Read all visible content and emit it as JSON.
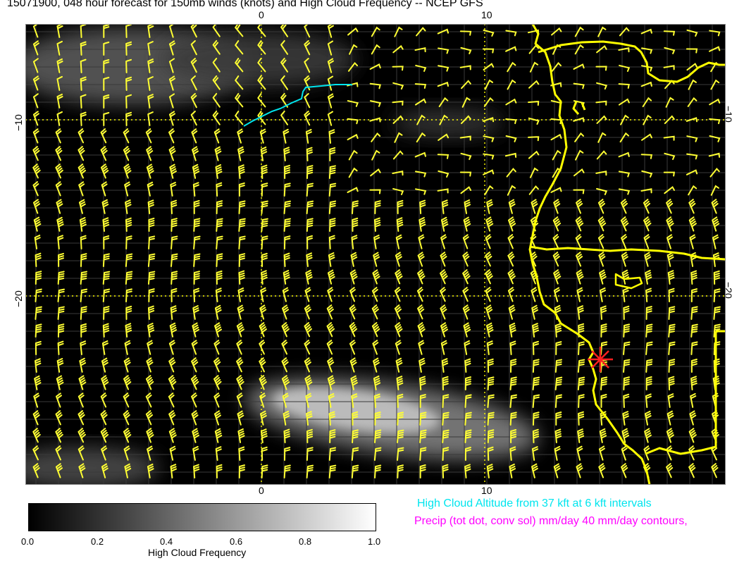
{
  "title": "15071900, 048 hour forecast for 150mb winds (knots) and High Cloud Frequency -- NCEP GFS",
  "axes": {
    "top_ticks": [
      "0",
      "10"
    ],
    "bottom_ticks": [
      "0",
      "10"
    ],
    "left_ticks": [
      "−10",
      "−20"
    ],
    "right_ticks": [
      "−10",
      "−20"
    ]
  },
  "legend": {
    "cloud_altitude_text": "High Cloud Altitude from 37 kft at 6 kft intervals",
    "precip_text": "Precip (tot dot, conv sol) mm/day 40 mm/day contours,",
    "colorbar_label": "High Cloud Frequency",
    "colorbar_ticks": [
      "0.0",
      "0.2",
      "0.4",
      "0.6",
      "0.8",
      "1.0"
    ]
  },
  "colors": {
    "map_background": "#000000",
    "wind_barbs": "#ffff33",
    "coastline": "#ffff00",
    "cloud_altitude": "#00e5ee",
    "precip": "#ff00ff",
    "storm_marker": "#ff2020"
  },
  "icons": {
    "storm_marker": "red-star-icon"
  }
}
